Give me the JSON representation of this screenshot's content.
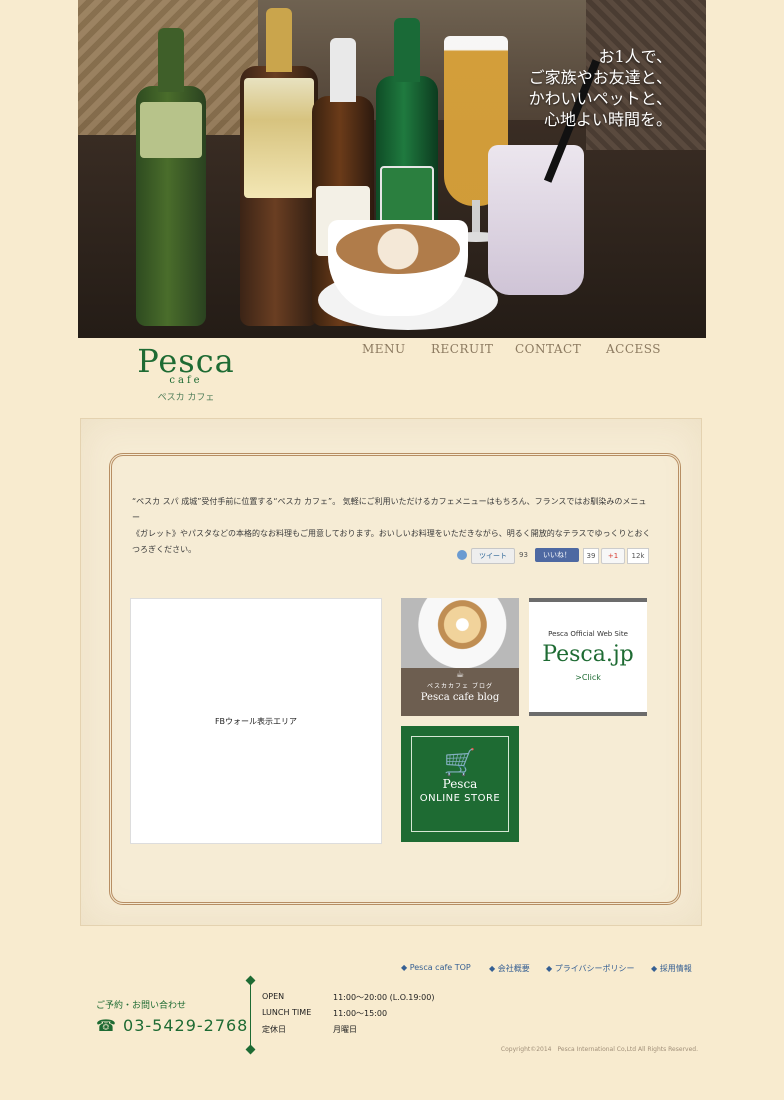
{
  "hero": {
    "copy_lines": [
      "お1人で、",
      "ご家族やお友達と、",
      "かわいいペットと、",
      "心地よい時間を。"
    ]
  },
  "brand": {
    "logo": "Pesca",
    "sub": "cafe",
    "kana": "ペスカ カフェ"
  },
  "nav": [
    "MENU",
    "RECRUIT",
    "CONTACT",
    "ACCESS"
  ],
  "main": {
    "intro_line1": "“ペスカ スパ 成城”受付手前に位置する“ペスカ カフェ”。 気軽にご利用いただけるカフェメニューはもちろん、フランスではお馴染みのメニュー",
    "intro_line2": "《ガレット》やパスタなどの本格的なお料理もご用意しております。おいしいお料理をいただきながら、明るく開放的なテラスでゆっくりとおく",
    "intro_line3": "つろぎください。",
    "share": {
      "tweet": "ツイート",
      "tweet_count": "93",
      "fb": "いいね！",
      "fb_count": "39",
      "gplus": "+1",
      "gplus_count": "12k"
    },
    "fb_area": "FBウォール表示エリア",
    "blog": {
      "ja": "ペスカカフェ ブログ",
      "en": "Pesca cafe blog"
    },
    "official": {
      "small": "Pesca Official Web Site",
      "title": "Pesca.jp",
      "click": ">Click"
    },
    "store": {
      "title": "Pesca",
      "subtitle": "ONLINE STORE"
    }
  },
  "footer": {
    "links": [
      "◆ Pesca cafe TOP",
      "◆ 会社概要",
      "◆ プライバシーポリシー",
      "◆ 採用情報"
    ],
    "contact_label": "ご予約・お問い合わせ",
    "tel": "☎ 03-5429-2768",
    "hours": [
      {
        "k": "OPEN",
        "v": "11:00～20:00 (L.O.19:00)"
      },
      {
        "k": "LUNCH TIME",
        "v": "11:00～15:00"
      },
      {
        "k": "定休日",
        "v": "月曜日"
      }
    ],
    "copyright": "Copyright©2014　Pesca International Co,Ltd All Rights Reserved."
  }
}
